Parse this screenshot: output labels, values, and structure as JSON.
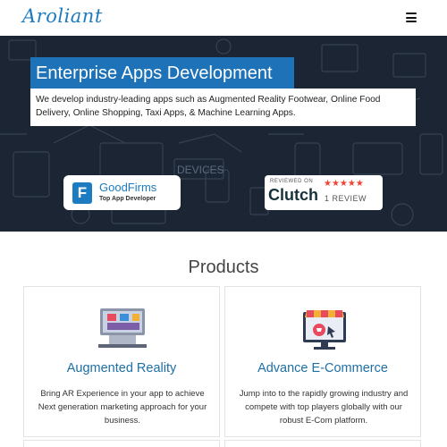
{
  "header": {
    "logo_text": "Aroliant",
    "menu_icon": "hamburger-menu-icon"
  },
  "hero": {
    "title": "Enterprise Apps Development",
    "description": "We develop industry-leading apps such as Augmented Reality Footwear, Online Food Delivery, Online Shopping, Taxi Apps, & Machine Learning Apps.",
    "bg_words": [
      "DEVICES"
    ],
    "goodfirms": {
      "logo_letter": "F",
      "name": "GoodFirms",
      "subtitle": "Top App Developer"
    },
    "clutch": {
      "reviewed_on": "REVIEWED ON",
      "name": "Clutch",
      "stars": "★★★★★",
      "review_count": "1 REVIEW"
    }
  },
  "products": {
    "heading": "Products",
    "items": [
      {
        "title": "Augmented Reality",
        "description": "Bring AR Experience in your app to achieve Next generation marketing approach for your business.",
        "icon": "ar-display-icon"
      },
      {
        "title": "Advance E-Commerce",
        "description": "Jump into to the rapidly growing industry and compete with top players globally with our robust E-Com platform.",
        "icon": "ecommerce-store-icon"
      }
    ]
  },
  "colors": {
    "brand_blue": "#1d72b8",
    "hero_bg": "#1b2533",
    "clutch_star": "#ef4335"
  }
}
